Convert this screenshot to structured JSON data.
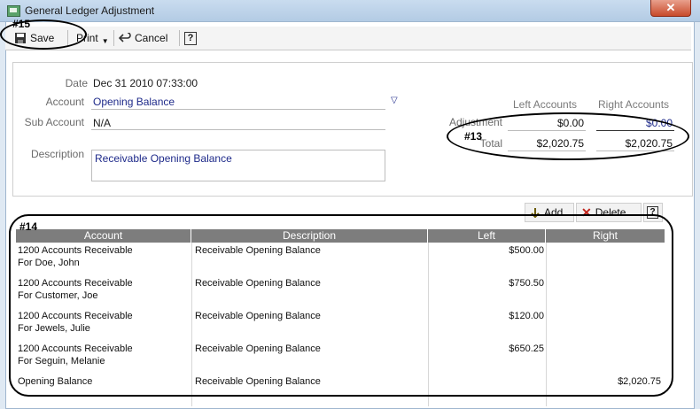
{
  "window": {
    "title": "General Ledger Adjustment",
    "close": "✕"
  },
  "toolbar": {
    "save": "Save",
    "print": "Print",
    "cancel": "Cancel",
    "help": "?"
  },
  "form": {
    "date_label": "Date",
    "date_value": "Dec 31 2010 07:33:00",
    "account_label": "Account",
    "account_value": "Opening Balance",
    "subaccount_label": "Sub Account",
    "subaccount_value": "N/A",
    "description_label": "Description",
    "description_value": "Receivable Opening Balance",
    "left_accounts_label": "Left Accounts",
    "right_accounts_label": "Right Accounts",
    "adjustment_label": "Adjustment",
    "total_label": "Total",
    "adjustment_left": "$0.00",
    "adjustment_right": "$0.00",
    "total_left": "$2,020.75",
    "total_right": "$2,020.75"
  },
  "grid_toolbar": {
    "add": "Add",
    "delete": "Delete",
    "help": "?"
  },
  "table": {
    "headers": [
      "Account",
      "Description",
      "Left",
      "Right"
    ],
    "rows": [
      {
        "account": "1200 Accounts Receivable",
        "account2": "For Doe, John",
        "description": "Receivable Opening Balance",
        "left": "$500.00",
        "right": ""
      },
      {
        "account": "1200 Accounts Receivable",
        "account2": "For Customer, Joe",
        "description": "Receivable Opening Balance",
        "left": "$750.50",
        "right": ""
      },
      {
        "account": "1200 Accounts Receivable",
        "account2": "For Jewels, Julie",
        "description": "Receivable Opening Balance",
        "left": "$120.00",
        "right": ""
      },
      {
        "account": "1200 Accounts Receivable",
        "account2": "For Seguin, Melanie",
        "description": "Receivable Opening Balance",
        "left": "$650.25",
        "right": ""
      },
      {
        "account": "Opening Balance",
        "account2": "",
        "description": "Receivable Opening Balance",
        "left": "",
        "right": "$2,020.75"
      }
    ]
  },
  "annotations": {
    "a15": "#15",
    "a13": "#13",
    "a14": "#14"
  }
}
